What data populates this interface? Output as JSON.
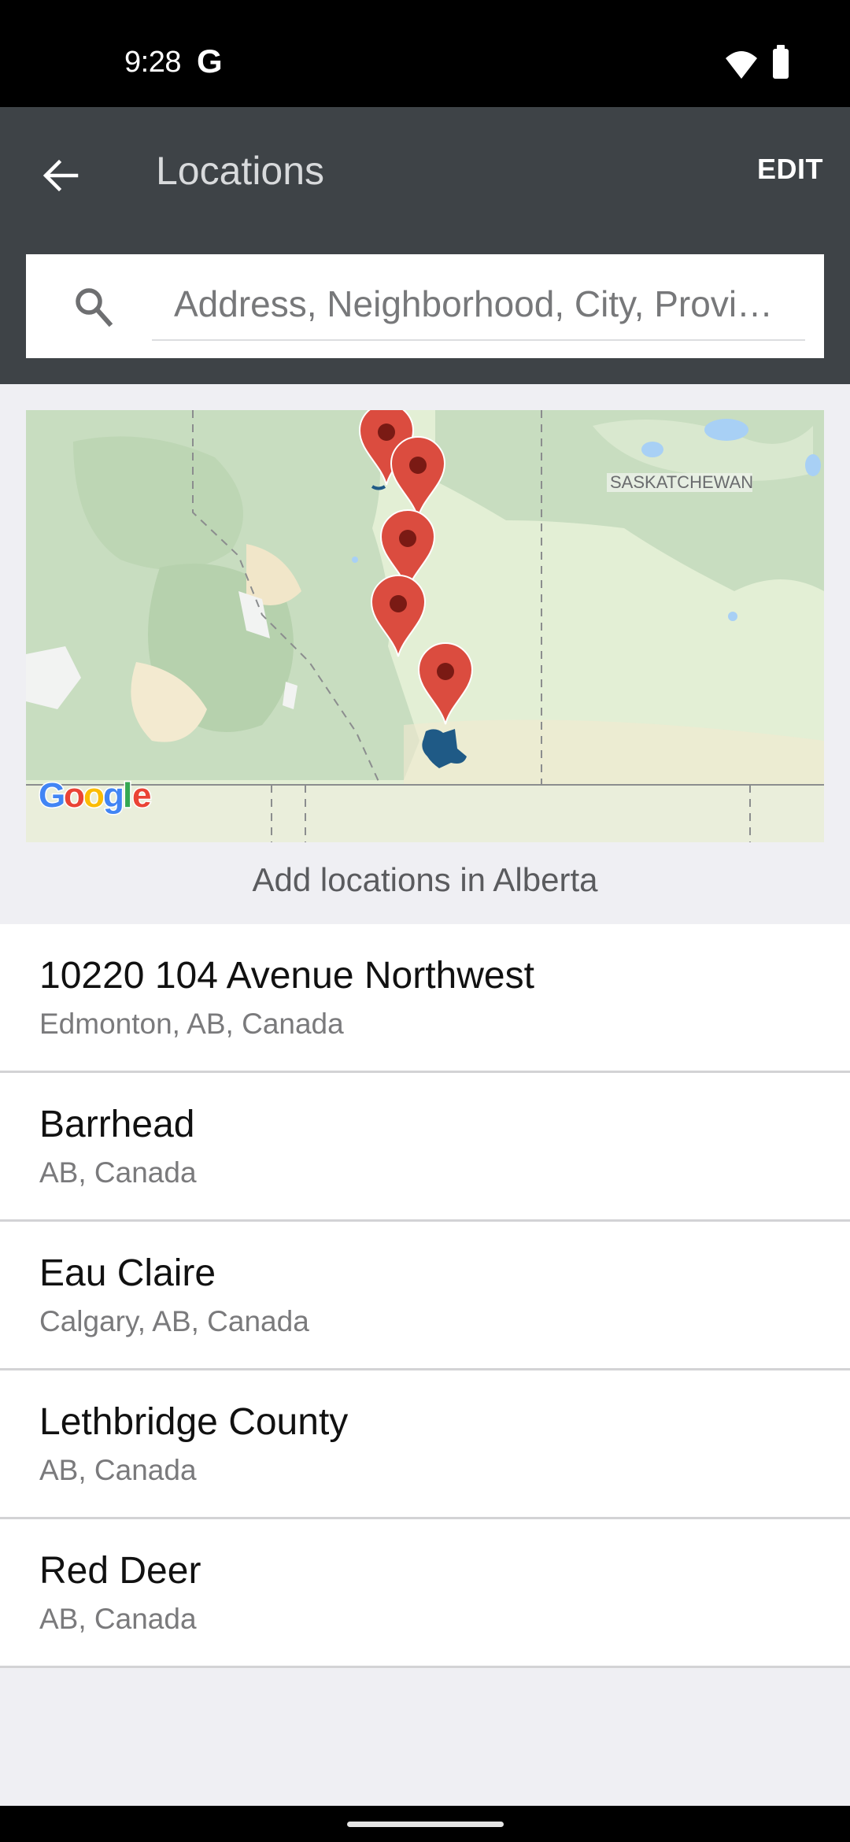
{
  "status_bar": {
    "time": "9:28",
    "carrier_icon": "G",
    "icons": [
      "wifi-icon",
      "battery-icon"
    ]
  },
  "app_bar": {
    "back_icon": "arrow-left-icon",
    "title": "Locations",
    "edit_label": "EDIT"
  },
  "search": {
    "icon": "search-icon",
    "placeholder": "Address, Neighborhood, City, Provi…",
    "value": ""
  },
  "map": {
    "region_label": "SASKATCHEWAN",
    "attribution": "Google",
    "marker_count": 5,
    "colors": {
      "marker": "#db4c3f",
      "marker_dot": "#7a1a14",
      "highlight_area": "#1f5a86",
      "land": "#e3efd5",
      "forest": "#c6dfbf",
      "water": "#a8d0f5"
    }
  },
  "hint": "Add locations in Alberta",
  "locations": [
    {
      "title": "10220 104 Avenue Northwest",
      "subtitle": "Edmonton, AB, Canada"
    },
    {
      "title": "Barrhead",
      "subtitle": "AB, Canada"
    },
    {
      "title": "Eau Claire",
      "subtitle": "Calgary, AB, Canada"
    },
    {
      "title": "Lethbridge County",
      "subtitle": "AB, Canada"
    },
    {
      "title": "Red Deer",
      "subtitle": "AB, Canada"
    }
  ],
  "colors": {
    "app_bar": "#3e4347",
    "background": "#efeff3",
    "divider": "#d3d3d5"
  }
}
